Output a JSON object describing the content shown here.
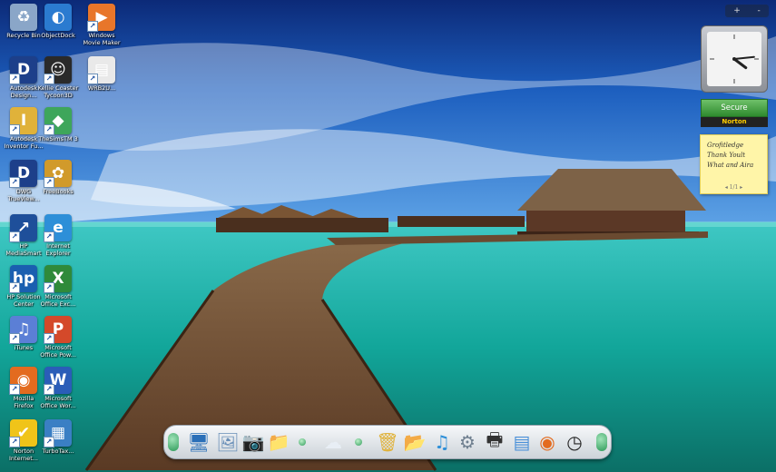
{
  "desktop_icons": [
    {
      "label": "Recycle Bin",
      "icon": "recycle-bin-icon",
      "color": "#8aa6c8",
      "glyph": "♻"
    },
    {
      "label": "ObjectDock",
      "icon": "objectdock-icon",
      "color": "#2b7bd0",
      "glyph": "◐"
    },
    {
      "label": "Windows\nMovie Maker",
      "icon": "movie-maker-icon",
      "color": "#e8762a",
      "glyph": "▶"
    },
    {
      "label": "Autodesk\nDesign...",
      "icon": "autodesk-design-review-icon",
      "color": "#1d3f8a",
      "glyph": "D"
    },
    {
      "label": "Kellie Coaster\nTycoon3D",
      "icon": "coaster-tycoon-icon",
      "color": "#2a2a2a",
      "glyph": "☺"
    },
    {
      "label": "WRB2U...",
      "icon": "video-file-icon",
      "color": "#e9e9e9",
      "glyph": "▤"
    },
    {
      "label": "Autodesk\nInventor Fu...",
      "icon": "autodesk-inventor-icon",
      "color": "#e0b23a",
      "glyph": "I"
    },
    {
      "label": "TheSimsTM 3",
      "icon": "sims3-icon",
      "color": "#3ea65b",
      "glyph": "◆"
    },
    {
      "label": "DWG\nTrueView...",
      "icon": "dwg-trueview-icon",
      "color": "#1d3f8a",
      "glyph": "D"
    },
    {
      "label": "FreeBooks",
      "icon": "pineapple-icon",
      "color": "#d19a2b",
      "glyph": "✿"
    },
    {
      "label": "HP\nMediaSmart",
      "icon": "hp-mediasmart-icon",
      "color": "#1e4f9a",
      "glyph": "↗"
    },
    {
      "label": "Internet\nExplorer",
      "icon": "internet-explorer-icon",
      "color": "#2d8fd8",
      "glyph": "e"
    },
    {
      "label": "HP Solution\nCenter",
      "icon": "hp-solution-center-icon",
      "color": "#1a5fb0",
      "glyph": "hp"
    },
    {
      "label": "Microsoft\nOffice Exc...",
      "icon": "excel-icon",
      "color": "#2f8a3a",
      "glyph": "X"
    },
    {
      "label": "iTunes",
      "icon": "itunes-icon",
      "color": "#5b7fd6",
      "glyph": "♫"
    },
    {
      "label": "Microsoft\nOffice Pow...",
      "icon": "powerpoint-icon",
      "color": "#d4492a",
      "glyph": "P"
    },
    {
      "label": "Mozilla\nFirefox",
      "icon": "firefox-icon",
      "color": "#e36b1f",
      "glyph": "◉"
    },
    {
      "label": "Microsoft\nOffice Wor...",
      "icon": "word-icon",
      "color": "#2a5db8",
      "glyph": "W"
    },
    {
      "label": "Norton\nInternet...",
      "icon": "norton-icon",
      "color": "#f0c419",
      "glyph": "✔"
    },
    {
      "label": "TurboTax...",
      "icon": "turbotax-icon",
      "color": "#3a7fc4",
      "glyph": "▦"
    }
  ],
  "gadgets": {
    "toolbar": {
      "add": "+",
      "minus": "-"
    },
    "clock": {
      "hour": 4,
      "minute": 14
    },
    "norton": {
      "status": "Secure",
      "brand": "Norton"
    },
    "sticky_note": {
      "text": "Grofitledge\nThank Yoult\nWhat and Aira",
      "pager": "1/1"
    }
  },
  "dock_items": [
    {
      "icon": "computer-icon",
      "glyph": "🖥"
    },
    {
      "icon": "pictures-icon",
      "glyph": "🖼"
    },
    {
      "icon": "camera-icon",
      "glyph": "📷"
    },
    {
      "icon": "program-files-icon",
      "glyph": "📁"
    },
    {
      "icon": "weather-icon",
      "glyph": "☁"
    },
    {
      "icon": "recycle-bin-icon",
      "glyph": "🗑"
    },
    {
      "icon": "documents-folder-icon",
      "glyph": "📂"
    },
    {
      "icon": "music-icon",
      "glyph": "♫"
    },
    {
      "icon": "settings-icon",
      "glyph": "⚙"
    },
    {
      "icon": "printer-icon",
      "glyph": "🖶"
    },
    {
      "icon": "control-panel-icon",
      "glyph": "▤"
    },
    {
      "icon": "firefox-icon",
      "glyph": "◉"
    },
    {
      "icon": "clock-icon",
      "glyph": "◷"
    }
  ]
}
